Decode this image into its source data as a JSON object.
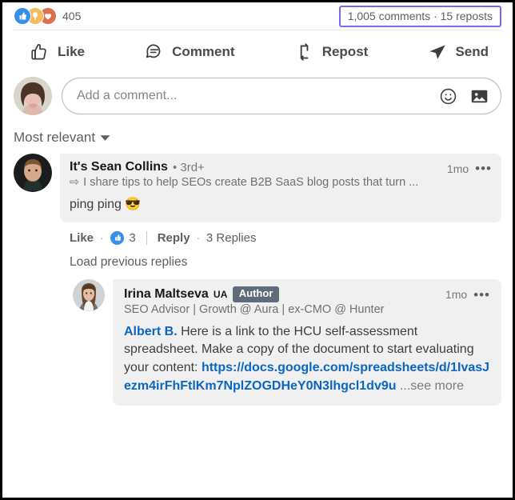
{
  "social_counts": {
    "reactions": [
      {
        "name": "like-reaction-icon",
        "color": "#378fe9",
        "glyph": "thumb"
      },
      {
        "name": "insight-reaction-icon",
        "color": "#f5bb5c",
        "glyph": "bulb"
      },
      {
        "name": "love-reaction-icon",
        "color": "#df704d",
        "glyph": "heart"
      }
    ],
    "reaction_count": "405",
    "comments_reposts": "1,005 comments · 15 reposts",
    "highlight_color": "#7b68ee"
  },
  "action_bar": {
    "like_label": "Like",
    "comment_label": "Comment",
    "repost_label": "Repost",
    "send_label": "Send"
  },
  "compose": {
    "placeholder": "Add a comment...",
    "emoji_icon": "emoji-smiley-icon",
    "image_icon": "image-icon"
  },
  "sort": {
    "label": "Most relevant",
    "chevron": "▾"
  },
  "comments": [
    {
      "name": "It's Sean Collins",
      "degree": "• 3rd+",
      "tagline_icon": "⇨",
      "tagline": "I share tips to help SEOs create B2B SaaS blog posts that turn ...",
      "time": "1mo",
      "more": "•••",
      "text": "ping ping 😎",
      "actions": {
        "like_label": "Like",
        "dot": "·",
        "like_count": "3",
        "reply_label": "Reply",
        "reply_dot": "·",
        "replies_label": "3 Replies"
      },
      "load_previous": "Load previous replies"
    }
  ],
  "reply": {
    "name": "Irina Maltseva",
    "name_suffix": "UA",
    "author_badge": "Author",
    "tagline": "SEO Advisor | Growth @ Aura | ex-CMO @ Hunter",
    "time": "1mo",
    "more": "•••",
    "mention": "Albert B.",
    "text_before_link": " Here is a link to the HCU self-assessment spreadsheet. Make a copy of the document to start evaluating your content: ",
    "link": "https://docs.google.com/spreadsheets/d/1IvasJezm4irFhFtlKm7NplZOGDHeY0N3lhgcl1dv9u",
    "see_more": " ...see more"
  }
}
